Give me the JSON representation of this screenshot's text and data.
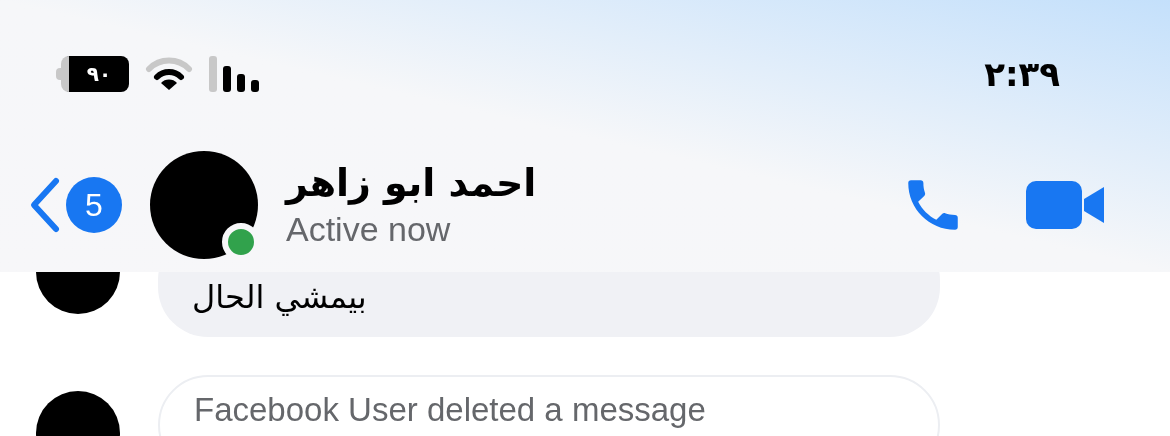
{
  "status_bar": {
    "time": "٢:٣٩",
    "battery": "٩٠"
  },
  "header": {
    "back_badge": "5",
    "name": "احمد ابو زاهر",
    "status": "Active now",
    "online": true
  },
  "messages": [
    {
      "kind": "text",
      "text": "بيمشي الحال"
    },
    {
      "kind": "deleted",
      "text": "Facebook User deleted a message"
    }
  ]
}
